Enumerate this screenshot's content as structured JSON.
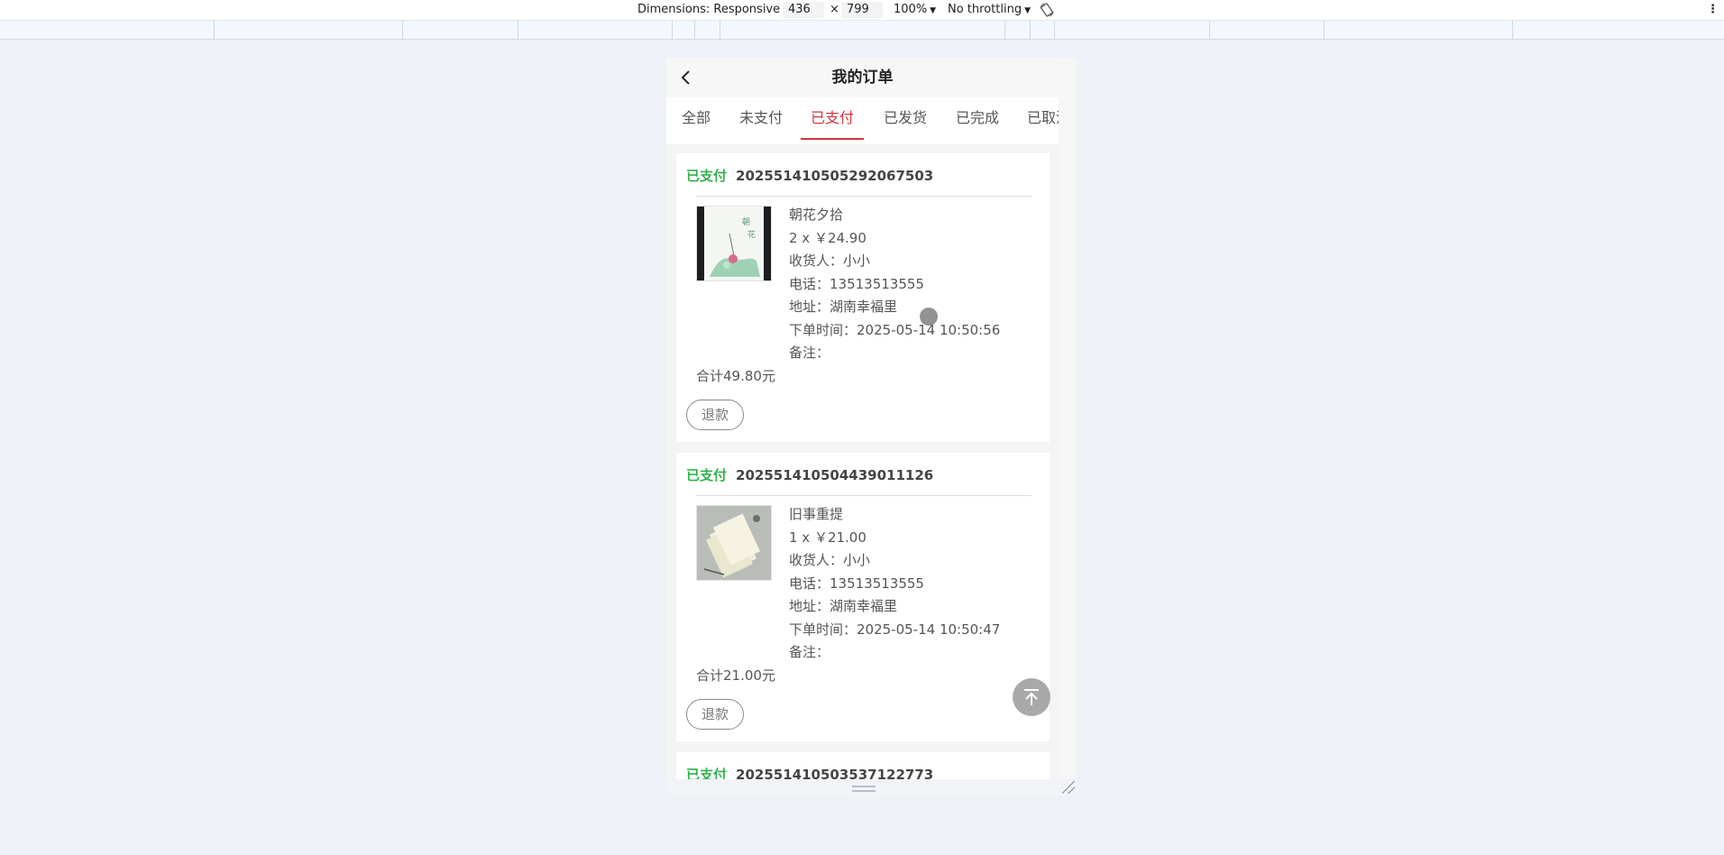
{
  "devtools": {
    "dimensions_label": "Dimensions: Responsive",
    "width": "436",
    "times": "×",
    "height": "799",
    "zoom": "100%",
    "throttling": "No throttling"
  },
  "app": {
    "title": "我的订单",
    "tabs": [
      {
        "label": "全部",
        "active": false
      },
      {
        "label": "未支付",
        "active": false
      },
      {
        "label": "已支付",
        "active": true
      },
      {
        "label": "已发货",
        "active": false
      },
      {
        "label": "已完成",
        "active": false
      },
      {
        "label": "已取消",
        "active": false
      }
    ],
    "orders": [
      {
        "status": "已支付",
        "order_no": "20255141050529206750 3",
        "product": "朝花夕拾",
        "qty_price": "2 x ￥24.90",
        "receiver": "收货人：小小",
        "phone": "电话：13513513555",
        "address": "地址：湖南幸福里",
        "order_time": "下单时间：2025-05-14 10:50:56",
        "note": "备注：",
        "total": "合计49.80元",
        "refund_label": "退款"
      },
      {
        "status": "已支付",
        "order_no": "20255141050443901112 6",
        "product": "旧事重提",
        "qty_price": "1 x ￥21.00",
        "receiver": "收货人：小小",
        "phone": "电话：13513513555",
        "address": "地址：湖南幸福里",
        "order_time": "下单时间：2025-05-14 10:50:47",
        "note": "备注：",
        "total": "合计21.00元",
        "refund_label": "退款"
      },
      {
        "status": "已支付",
        "order_no": "20255141050353712277 3"
      }
    ]
  }
}
